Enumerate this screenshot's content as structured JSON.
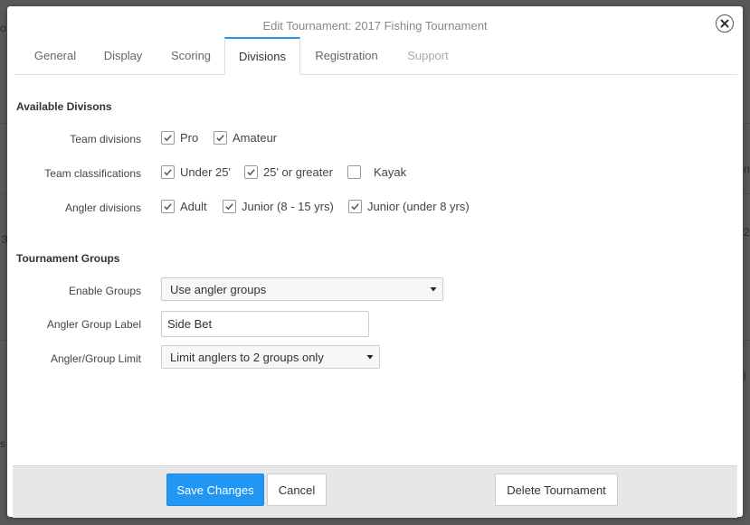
{
  "background": {
    "fragments": [
      "o",
      "n",
      "3",
      "2",
      "s",
      "l"
    ]
  },
  "modal": {
    "title": "Edit Tournament: 2017 Fishing Tournament",
    "close_icon": "close-icon"
  },
  "tabs": [
    {
      "label": "General",
      "state": "normal"
    },
    {
      "label": "Display",
      "state": "normal"
    },
    {
      "label": "Scoring",
      "state": "normal"
    },
    {
      "label": "Divisions",
      "state": "active"
    },
    {
      "label": "Registration",
      "state": "normal"
    },
    {
      "label": "Support",
      "state": "disabled"
    }
  ],
  "divisions": {
    "title": "Available Divisons",
    "team_divisions": {
      "label": "Team divisions",
      "options": [
        {
          "label": "Pro",
          "checked": true
        },
        {
          "label": "Amateur",
          "checked": true
        }
      ]
    },
    "team_classifications": {
      "label": "Team classifications",
      "options": [
        {
          "label": "Under 25'",
          "checked": true
        },
        {
          "label": "25' or greater",
          "checked": true
        },
        {
          "label": "Kayak",
          "checked": false
        }
      ]
    },
    "angler_divisions": {
      "label": "Angler divisions",
      "options": [
        {
          "label": "Adult",
          "checked": true
        },
        {
          "label": "Junior (8 - 15 yrs)",
          "checked": true
        },
        {
          "label": "Junior (under 8 yrs)",
          "checked": true
        }
      ]
    }
  },
  "groups": {
    "title": "Tournament Groups",
    "enable_groups": {
      "label": "Enable Groups",
      "value": "Use angler groups"
    },
    "angler_group_label": {
      "label": "Angler Group Label",
      "value": "Side Bet"
    },
    "group_limit": {
      "label": "Angler/Group Limit",
      "value": "Limit anglers to 2 groups only"
    }
  },
  "footer": {
    "save": "Save Changes",
    "cancel": "Cancel",
    "delete": "Delete Tournament"
  },
  "colors": {
    "accent": "#2196f3",
    "footer_bg": "#e7e7e7"
  }
}
